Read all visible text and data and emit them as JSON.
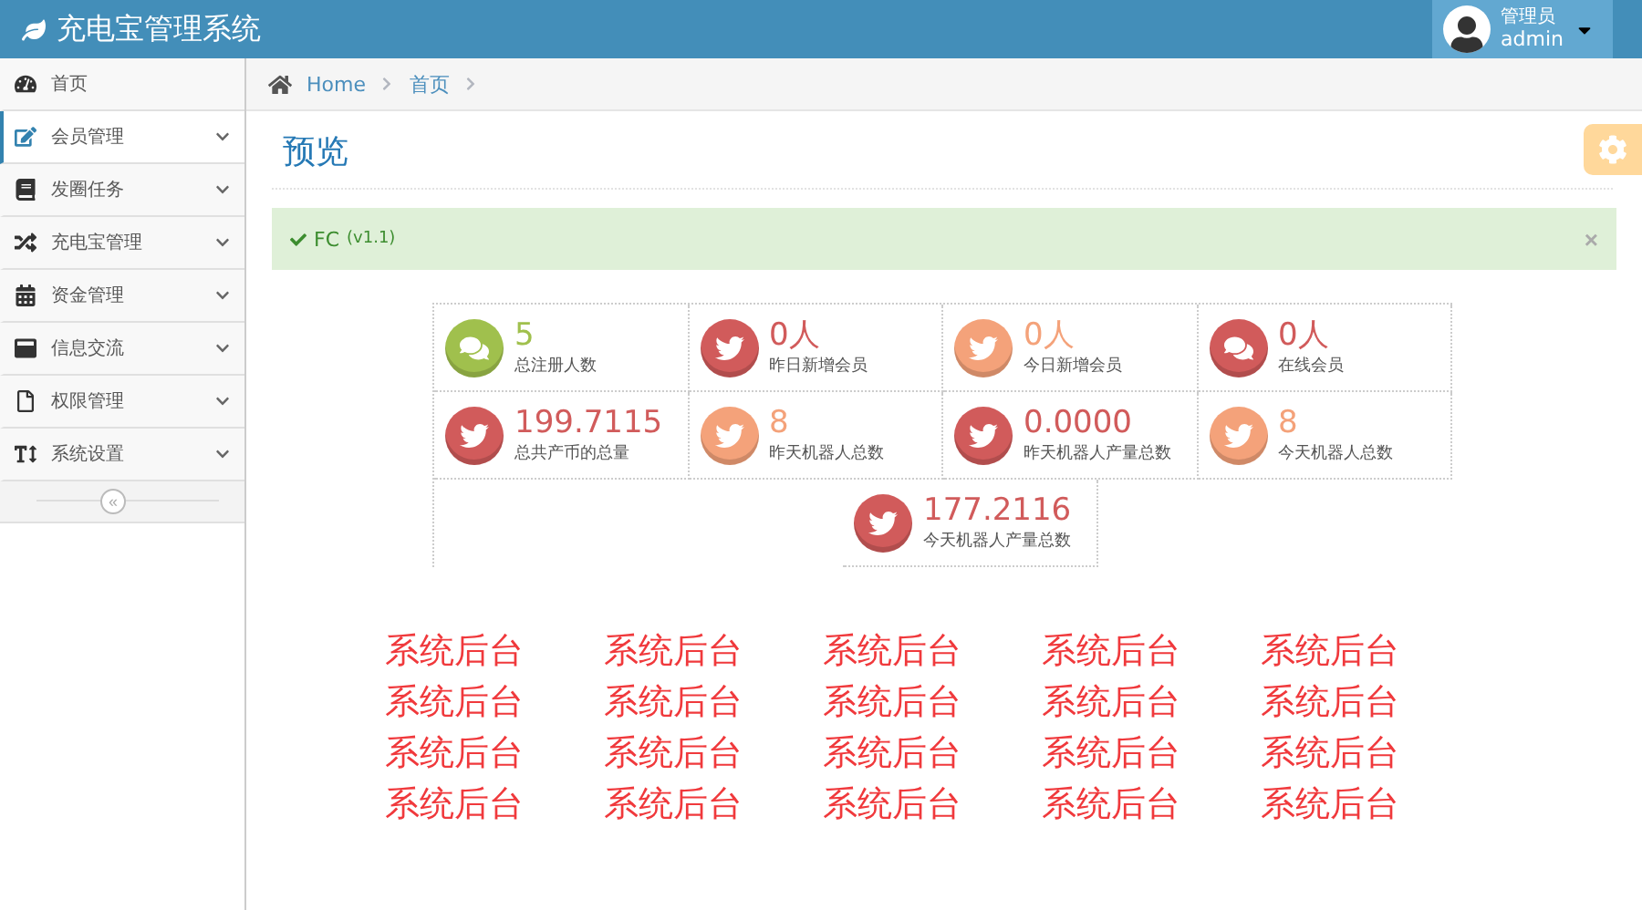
{
  "app": {
    "title": "充电宝管理系统"
  },
  "user": {
    "role": "管理员",
    "name": "admin"
  },
  "sidebar": {
    "items": [
      {
        "label": "首页",
        "selected": false,
        "expandable": false
      },
      {
        "label": "会员管理",
        "selected": true,
        "expandable": true
      },
      {
        "label": "发圈任务",
        "selected": false,
        "expandable": true
      },
      {
        "label": "充电宝管理",
        "selected": false,
        "expandable": true
      },
      {
        "label": "资金管理",
        "selected": false,
        "expandable": true
      },
      {
        "label": "信息交流",
        "selected": false,
        "expandable": true
      },
      {
        "label": "权限管理",
        "selected": false,
        "expandable": true
      },
      {
        "label": "系统设置",
        "selected": false,
        "expandable": true
      }
    ],
    "collapse": "«"
  },
  "breadcrumb": [
    "Home",
    "首页"
  ],
  "page_title": "预览",
  "alert": {
    "title": "FC",
    "version": "(v1.1)",
    "close": "×"
  },
  "stats": [
    {
      "value": "5",
      "label": "总注册人数",
      "kind": "comments",
      "color": "#a0c04d"
    },
    {
      "value": "0人",
      "label": "昨日新增会员",
      "kind": "bird",
      "color": "#d15b5b"
    },
    {
      "value": "0人",
      "label": "今日新增会员",
      "kind": "bird",
      "color": "#f4a27a"
    },
    {
      "value": "0人",
      "label": "在线会员",
      "kind": "comments",
      "color": "#d15b5b"
    },
    {
      "value": "199.7115",
      "label": "总共产币的总量",
      "kind": "bird",
      "color": "#d15b5b"
    },
    {
      "value": "8",
      "label": "昨天机器人总数",
      "kind": "bird",
      "color": "#f4a27a"
    },
    {
      "value": "0.0000",
      "label": "昨天机器人产量总数",
      "kind": "bird",
      "color": "#d15b5b"
    },
    {
      "value": "8",
      "label": "今天机器人总数",
      "kind": "bird",
      "color": "#f4a27a"
    },
    {
      "value": "177.2116",
      "label": "今天机器人产量总数",
      "kind": "bird",
      "color": "#d15b5b"
    }
  ],
  "banner_texts": [
    "系统后台",
    "系统后台",
    "系统后台",
    "系统后台",
    "系统后台",
    "系统后台",
    "系统后台",
    "系统后台",
    "系统后台",
    "系统后台",
    "系统后台",
    "系统后台",
    "系统后台",
    "系统后台",
    "系统后台",
    "系统后台",
    "系统后台",
    "系统后台",
    "系统后台",
    "系统后台"
  ]
}
